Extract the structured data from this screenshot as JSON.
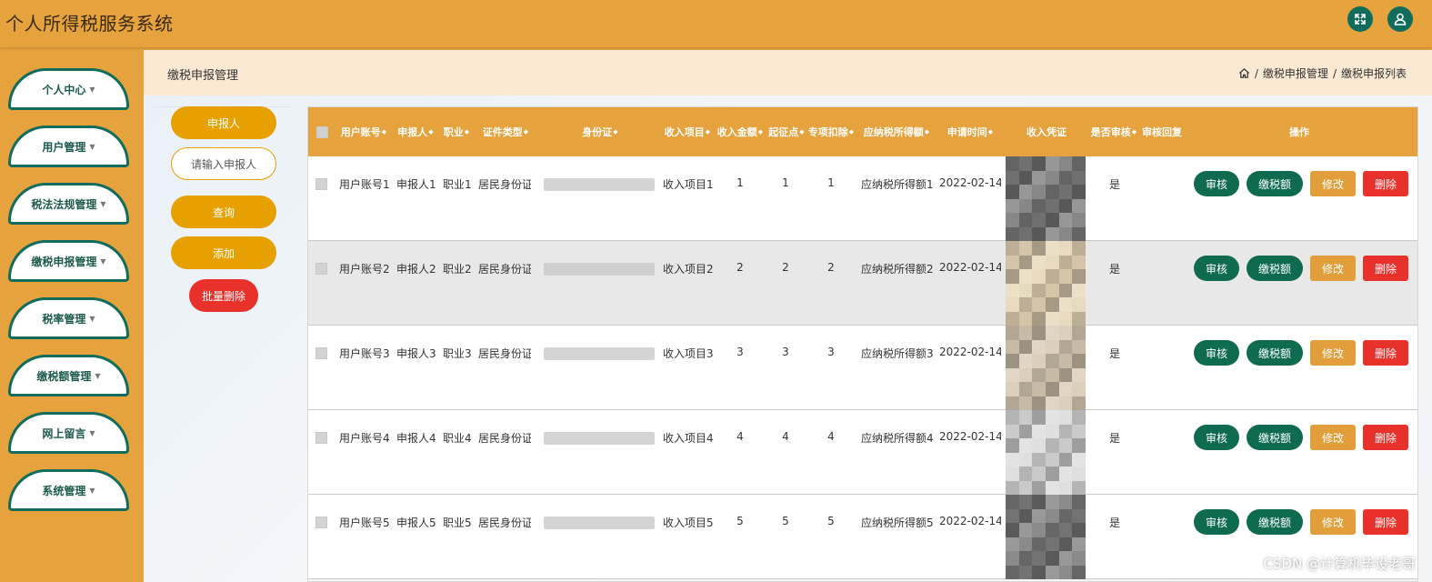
{
  "app": {
    "title": "个人所得税服务系统"
  },
  "header": {
    "fullscreen_icon": "fullscreen-icon",
    "user_icon": "user-icon",
    "accent": "#126c5c"
  },
  "sidebar": {
    "items": [
      {
        "label": "个人中心"
      },
      {
        "label": "用户管理"
      },
      {
        "label": "税法法规管理"
      },
      {
        "label": "缴税申报管理"
      },
      {
        "label": "税率管理"
      },
      {
        "label": "缴税额管理"
      },
      {
        "label": "网上留言"
      },
      {
        "label": "系统管理"
      }
    ]
  },
  "page": {
    "title": "缴税申报管理",
    "breadcrumbs": [
      "缴税申报管理",
      "缴税申报列表"
    ]
  },
  "search": {
    "field_label": "申报人",
    "placeholder": "请输入申报人",
    "query_label": "查询",
    "add_label": "添加",
    "batch_delete_label": "批量删除"
  },
  "table": {
    "columns": [
      "用户账号",
      "申报人",
      "职业",
      "证件类型",
      "身份证",
      "收入项目",
      "收入金额",
      "起征点",
      "专项扣除",
      "应纳税所得额",
      "申请时间",
      "收入凭证",
      "是否审核",
      "审核回复",
      "操作"
    ],
    "rows": [
      {
        "account": "用户账号1",
        "applicant": "申报人1",
        "job": "职业1",
        "id_type": "居民身份证",
        "income_item": "收入项目1",
        "amount": "1",
        "threshold": "1",
        "deduction": "1",
        "taxable": "应纳税所得额1",
        "date": "2022-02-14",
        "audited": "是"
      },
      {
        "account": "用户账号2",
        "applicant": "申报人2",
        "job": "职业2",
        "id_type": "居民身份证",
        "income_item": "收入项目2",
        "amount": "2",
        "threshold": "2",
        "deduction": "2",
        "taxable": "应纳税所得额2",
        "date": "2022-02-14",
        "audited": "是"
      },
      {
        "account": "用户账号3",
        "applicant": "申报人3",
        "job": "职业3",
        "id_type": "居民身份证",
        "income_item": "收入项目3",
        "amount": "3",
        "threshold": "3",
        "deduction": "3",
        "taxable": "应纳税所得额3",
        "date": "2022-02-14",
        "audited": "是"
      },
      {
        "account": "用户账号4",
        "applicant": "申报人4",
        "job": "职业4",
        "id_type": "居民身份证",
        "income_item": "收入项目4",
        "amount": "4",
        "threshold": "4",
        "deduction": "4",
        "taxable": "应纳税所得额4",
        "date": "2022-02-14",
        "audited": "是"
      },
      {
        "account": "用户账号5",
        "applicant": "申报人5",
        "job": "职业5",
        "id_type": "居民身份证",
        "income_item": "收入项目5",
        "amount": "5",
        "threshold": "5",
        "deduction": "5",
        "taxable": "应纳税所得额5",
        "date": "2022-02-14",
        "audited": "是"
      }
    ],
    "actions": {
      "audit": "审核",
      "tax": "缴税额",
      "edit": "修改",
      "delete": "删除"
    }
  },
  "watermark": "CSDN @计算机毕设老哥",
  "colors": {
    "header": "#e6a23c",
    "green": "#0f6b4f",
    "orange": "#e19e3a",
    "red": "#e8312a",
    "pill": "#e6a000"
  }
}
